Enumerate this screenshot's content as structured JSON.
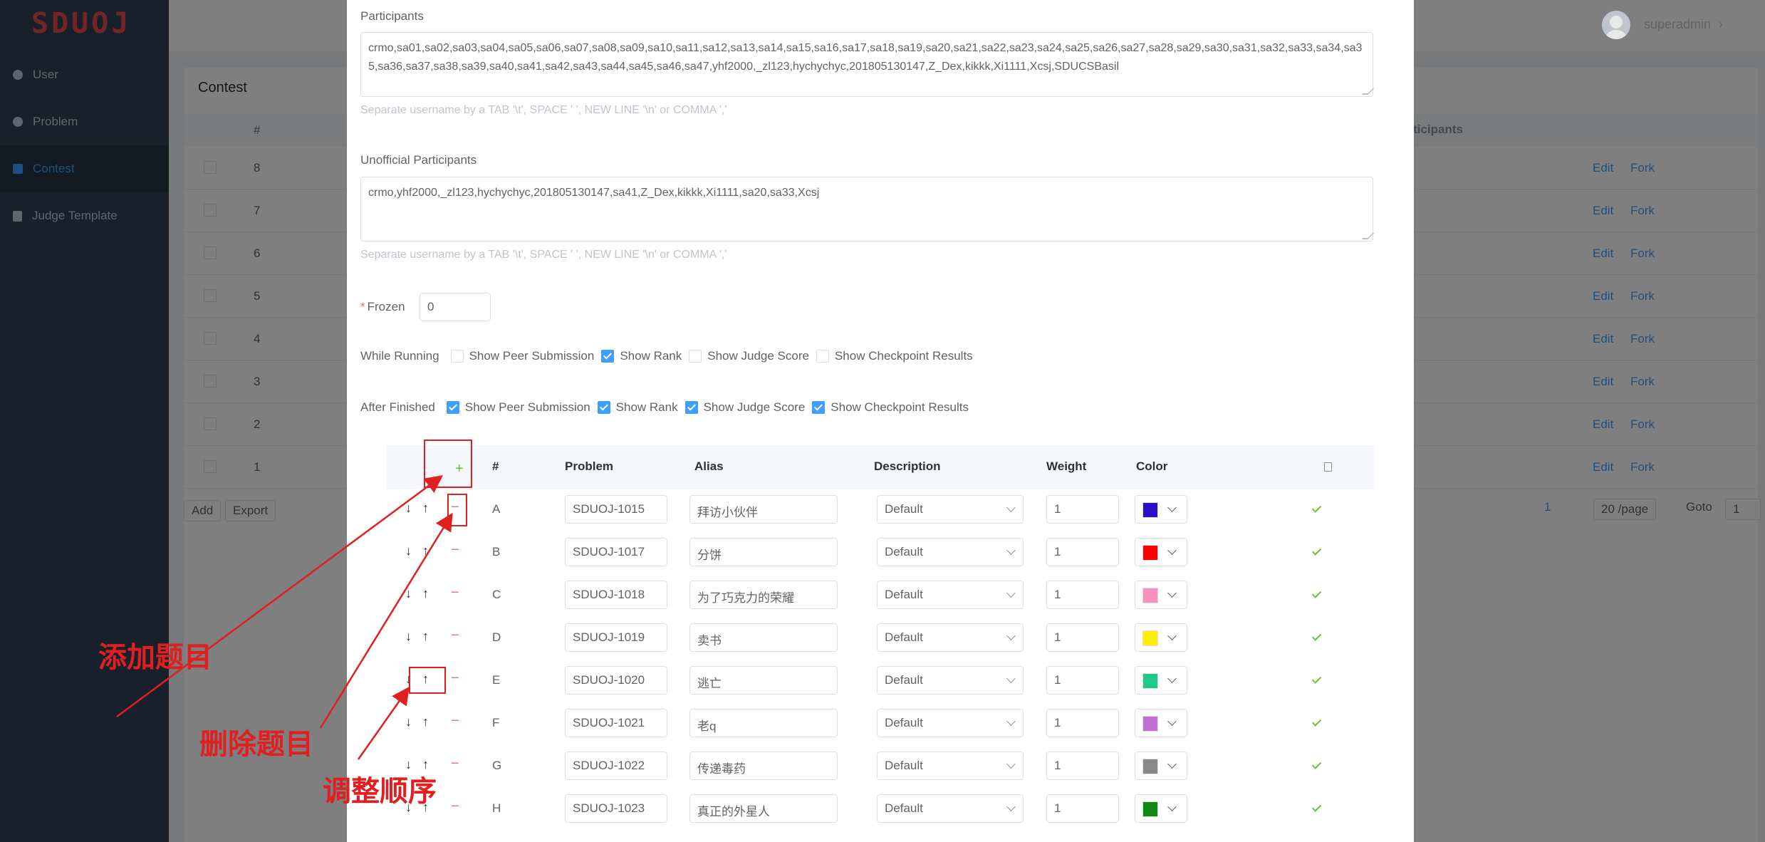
{
  "app": {
    "logo": "SDUOJ",
    "user": "superadmin",
    "user_chevron": "›"
  },
  "sidebar": {
    "items": [
      {
        "label": "User",
        "icon": "user-icon"
      },
      {
        "label": "Problem",
        "icon": "problem-icon"
      },
      {
        "label": "Contest",
        "icon": "grid-icon",
        "active": true
      },
      {
        "label": "Judge Template",
        "icon": "document-icon"
      }
    ]
  },
  "background": {
    "section_title": "Contest",
    "col_hash": "#",
    "col_participants": "articipants",
    "rows": [
      "8",
      "7",
      "6",
      "5",
      "4",
      "3",
      "2",
      "1"
    ],
    "edit": "Edit",
    "fork": "Fork",
    "add": "Add",
    "export": "Export",
    "page": "1",
    "per_page": "20 /page",
    "goto": "Goto",
    "goto_value": "1"
  },
  "form": {
    "participants_label": "Participants",
    "participants_value": "crmo,sa01,sa02,sa03,sa04,sa05,sa06,sa07,sa08,sa09,sa10,sa11,sa12,sa13,sa14,sa15,sa16,sa17,sa18,sa19,sa20,sa21,sa22,sa23,sa24,sa25,sa26,sa27,sa28,sa29,sa30,sa31,sa32,sa33,sa34,sa35,sa36,sa37,sa38,sa39,sa40,sa41,sa42,sa43,sa44,sa45,sa46,sa47,yhf2000,_zl123,hychychyc,201805130147,Z_Dex,kikkk,Xi1111,Xcsj,SDUCSBasil",
    "hint": "Separate username by a TAB '\\t', SPACE ' ', NEW LINE '\\n' or COMMA ','",
    "unofficial_label": "Unofficial Participants",
    "unofficial_value": "crmo,yhf2000,_zl123,hychychyc,201805130147,sa41,Z_Dex,kikkk,Xi1111,sa20,sa33,Xcsj",
    "frozen_label": "Frozen",
    "frozen_required": "*",
    "frozen_value": "0",
    "while_running": {
      "label": "While Running",
      "options": [
        {
          "label": "Show Peer Submission",
          "checked": false
        },
        {
          "label": "Show Rank",
          "checked": true
        },
        {
          "label": "Show Judge Score",
          "checked": false
        },
        {
          "label": "Show Checkpoint Results",
          "checked": false
        }
      ]
    },
    "after_finished": {
      "label": "After Finished",
      "options": [
        {
          "label": "Show Peer Submission",
          "checked": true
        },
        {
          "label": "Show Rank",
          "checked": true
        },
        {
          "label": "Show Judge Score",
          "checked": true
        },
        {
          "label": "Show Checkpoint Results",
          "checked": true
        }
      ]
    }
  },
  "problems": {
    "add_symbol": "+",
    "headers": {
      "hash": "#",
      "problem": "Problem",
      "alias": "Alias",
      "description": "Description",
      "weight": "Weight",
      "color": "Color"
    },
    "down_symbol": "↓",
    "up_symbol": "↑",
    "remove_symbol": "−",
    "rows": [
      {
        "letter": "A",
        "code": "SDUOJ-1015",
        "alias": "拜访小伙伴",
        "description": "Default",
        "weight": "1",
        "color": "#2a10c8"
      },
      {
        "letter": "B",
        "code": "SDUOJ-1017",
        "alias": "分饼",
        "description": "Default",
        "weight": "1",
        "color": "#ff0000"
      },
      {
        "letter": "C",
        "code": "SDUOJ-1018",
        "alias": "为了巧克力的荣耀",
        "description": "Default",
        "weight": "1",
        "color": "#f78fc1"
      },
      {
        "letter": "D",
        "code": "SDUOJ-1019",
        "alias": "卖书",
        "description": "Default",
        "weight": "1",
        "color": "#ffee00"
      },
      {
        "letter": "E",
        "code": "SDUOJ-1020",
        "alias": "逃亡",
        "description": "Default",
        "weight": "1",
        "color": "#1ec98a"
      },
      {
        "letter": "F",
        "code": "SDUOJ-1021",
        "alias": "老q",
        "description": "Default",
        "weight": "1",
        "color": "#c36fd6"
      },
      {
        "letter": "G",
        "code": "SDUOJ-1022",
        "alias": "传递毒药",
        "description": "Default",
        "weight": "1",
        "color": "#888888"
      },
      {
        "letter": "H",
        "code": "SDUOJ-1023",
        "alias": "真正的外星人",
        "description": "Default",
        "weight": "1",
        "color": "#0c8a12"
      }
    ]
  },
  "annotations": {
    "add_problem": "添加题目",
    "delete_problem": "删除题目",
    "reorder": "调整顺序",
    "color": "#e02020"
  }
}
